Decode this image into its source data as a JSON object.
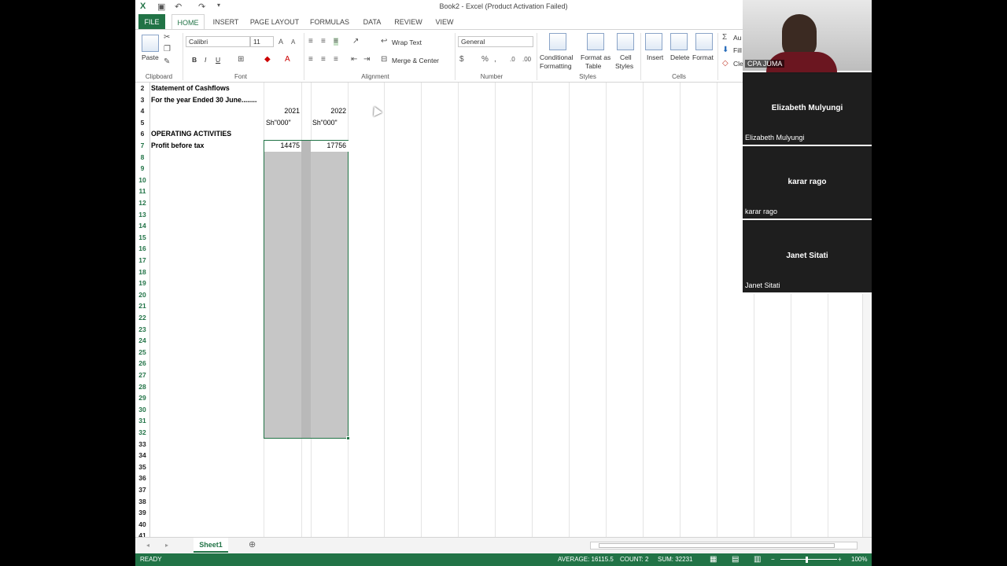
{
  "window": {
    "title": "Book2 - Excel (Product Activation Failed)"
  },
  "tabs": [
    "FILE",
    "HOME",
    "INSERT",
    "PAGE LAYOUT",
    "FORMULAS",
    "DATA",
    "REVIEW",
    "VIEW"
  ],
  "ribbon": {
    "clipboard": {
      "paste": "Paste",
      "label": "Clipboard"
    },
    "font": {
      "name": "Calibri",
      "size": "11",
      "bold": "B",
      "italic": "I",
      "underline": "U",
      "label": "Font"
    },
    "alignment": {
      "wrap": "Wrap Text",
      "merge": "Merge & Center",
      "label": "Alignment"
    },
    "number": {
      "format": "General",
      "label": "Number"
    },
    "styles": {
      "conditional_1": "Conditional",
      "conditional_2": "Formatting",
      "format_table_1": "Format as",
      "format_table_2": "Table",
      "cell_styles_1": "Cell",
      "cell_styles_2": "Styles",
      "label": "Styles"
    },
    "cells": {
      "insert": "Insert",
      "delete": "Delete",
      "format": "Format",
      "label": "Cells"
    },
    "editing": {
      "autosum": "Au",
      "fill": "Fill",
      "clear": "Cle"
    }
  },
  "sheet": {
    "rows": [
      "2",
      "3",
      "4",
      "5",
      "6",
      "7",
      "8",
      "9",
      "10",
      "11",
      "12",
      "13",
      "14",
      "15",
      "16",
      "17",
      "18",
      "19",
      "20",
      "21",
      "22",
      "23",
      "24",
      "25",
      "26",
      "27",
      "28",
      "29",
      "30",
      "31",
      "32",
      "33",
      "34",
      "35",
      "36",
      "37",
      "38",
      "39",
      "40",
      "41"
    ],
    "cells": {
      "a2": "Statement of Cashflows",
      "a3": "For the year Ended 30 June........",
      "b4": "2021",
      "c4": "2022",
      "b5": "Sh\"000\"",
      "c5": "Sh\"000\"",
      "a6": "OPERATING ACTIVITIES",
      "a7": "Profit before tax",
      "b7": "14475",
      "c7": "17756"
    }
  },
  "sheet_tab": "Sheet1",
  "status": {
    "mode": "READY",
    "average": "AVERAGE: 16115.5",
    "count": "COUNT: 2",
    "sum": "SUM: 32231",
    "zoom": "100%"
  },
  "participants": [
    {
      "tile_name": "",
      "label": "CPA JUMA"
    },
    {
      "tile_name": "Elizabeth Mulyungi",
      "label": "Elizabeth Mulyungi"
    },
    {
      "tile_name": "karar rago",
      "label": "karar rago"
    },
    {
      "tile_name": "Janet Sitati",
      "label": "Janet Sitati"
    }
  ]
}
